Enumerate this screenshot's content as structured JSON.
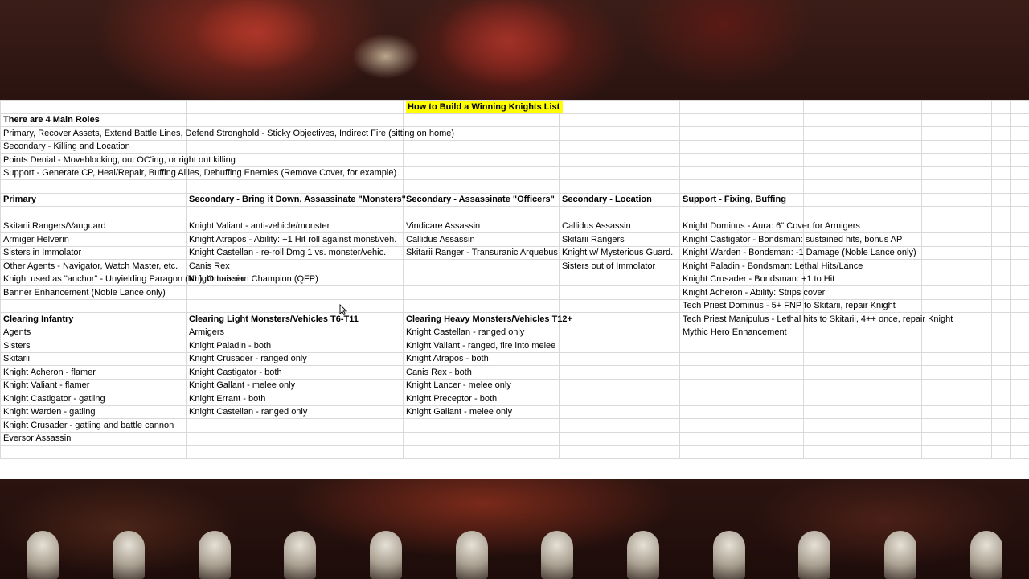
{
  "sheet": {
    "title": "How to Build a Winning Knights List",
    "roles_heading": "There are 4 Main Roles",
    "roles": [
      "Primary, Recover Assets, Extend Battle Lines, Defend Stronghold - Sticky Objectives, Indirect Fire (sitting on home)",
      "Secondary - Killing and Location",
      "Points Denial - Moveblocking, out OC'ing, or right out killing",
      "Support - Generate CP, Heal/Repair, Buffing Allies, Debuffing Enemies (Remove Cover, for example)"
    ],
    "role_headers": [
      "Primary",
      "Secondary - Bring it Down, Assassinate \"Monsters\"",
      "Secondary - Assassinate \"Officers\"",
      "Secondary - Location",
      "Support - Fixing, Buffing"
    ],
    "role_rows": [
      [
        "Skitarii Rangers/Vanguard",
        "Knight Valiant - anti-vehicle/monster",
        "Vindicare Assassin",
        "Callidus Assassin",
        "Knight Dominus - Aura: 6\" Cover for Armigers"
      ],
      [
        "Armiger Helverin",
        "Knight Atrapos - Ability: +1 Hit roll against monst/veh.",
        "Callidus Assassin",
        "Skitarii Rangers",
        "Knight Castigator - Bondsman: sustained hits, bonus AP"
      ],
      [
        "Sisters in Immolator",
        "Knight Castellan - re-roll Dmg 1 vs. monster/vehic.",
        "Skitarii Ranger - Transuranic Arquebus",
        "Knight w/ Mysterious Guard.",
        "Knight Warden - Bondsman: -1 Damage (Noble Lance only)"
      ],
      [
        "Other Agents - Navigator, Watch Master, etc.",
        "Canis Rex",
        "",
        "Sisters out of Immolator",
        "Knight Paladin - Bondsman: Lethal Hits/Lance"
      ]
    ],
    "anchor_text": "Knight used as \"anchor\" - Unyielding Paragon (NL), Omnissian Champion (QFP)",
    "anchor_row": [
      "",
      "Knight Lancer",
      "",
      "",
      "Knight Crusader - Bondsman: +1 to Hit"
    ],
    "banner_row": [
      "Banner Enhancement (Noble Lance only)",
      "",
      "",
      "",
      "Knight Acheron - Ability: Strips cover"
    ],
    "support_extra": "Tech Priest Dominus - 5+ FNP to Skitarii, repair Knight",
    "clearing_headers": [
      "Clearing Infantry",
      "Clearing Light Monsters/Vehicles T6-T11",
      "Clearing Heavy Monsters/Vehicles T12+"
    ],
    "clearing_support": [
      "Tech Priest Manipulus - Lethal hits to Skitarii, 4++ once, repair Knight",
      "Mythic Hero Enhancement"
    ],
    "clearing_rows": [
      [
        "Agents",
        "Armigers",
        "Knight Castellan - ranged only"
      ],
      [
        "Sisters",
        "Knight Paladin - both",
        "Knight Valiant - ranged, fire into melee"
      ],
      [
        "Skitarii",
        "Knight Crusader - ranged only",
        "Knight Atrapos - both"
      ],
      [
        "Knight Acheron - flamer",
        "Knight Castigator - both",
        "Canis Rex - both"
      ],
      [
        "Knight Valiant - flamer",
        "Knight Gallant - melee only",
        "Knight Lancer - melee only"
      ],
      [
        "Knight Castigator - gatling",
        "Knight Errant - both",
        "Knight Preceptor - both"
      ],
      [
        "Knight Warden - gatling",
        "Knight Castellan - ranged only",
        "Knight Gallant - melee only"
      ],
      [
        "Knight Crusader - gatling and battle cannon",
        "",
        ""
      ],
      [
        "Eversor Assassin",
        "",
        ""
      ]
    ]
  },
  "colors": {
    "highlight": "#ffff00",
    "gridline": "#d9d9d9"
  }
}
